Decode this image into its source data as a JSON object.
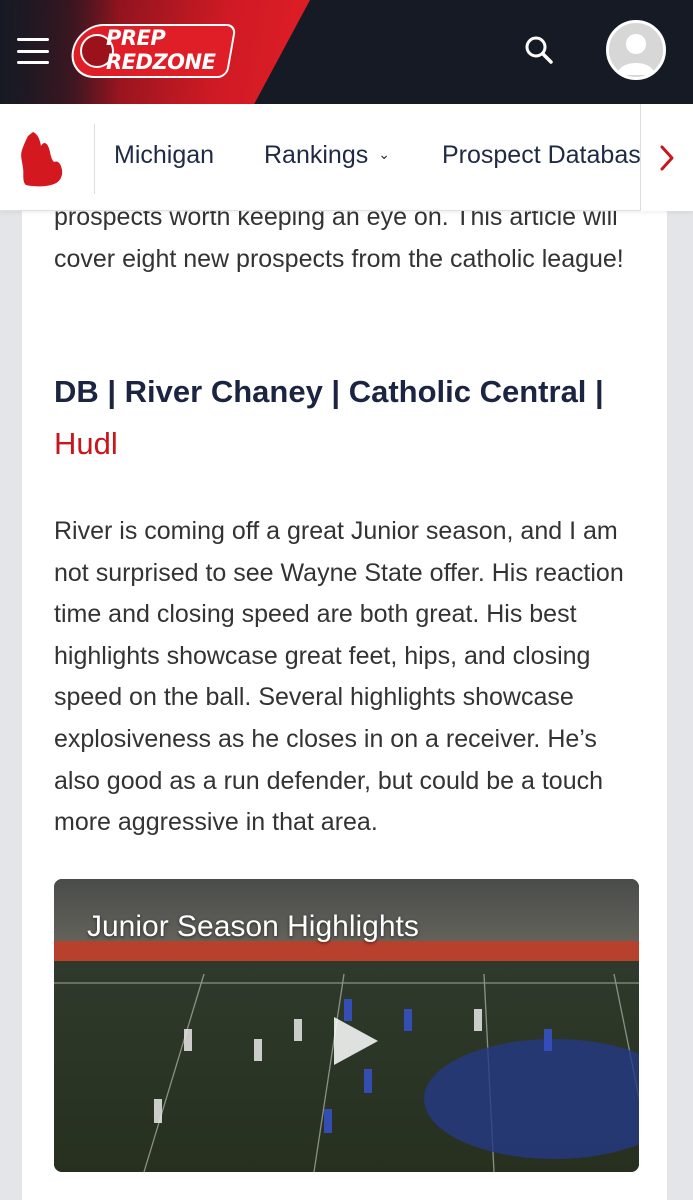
{
  "header": {
    "logo_line1": "PREP",
    "logo_line2": "REDZONE",
    "brand_color": "#e01e27",
    "header_bg": "#161a25"
  },
  "nav": {
    "state_icon": "michigan-state-icon",
    "items": [
      {
        "label": "Michigan"
      },
      {
        "label": "Rankings",
        "has_dropdown": true
      },
      {
        "label": "Prospect Database"
      }
    ]
  },
  "article": {
    "intro": "prospects worth keeping an eye on. This article will cover eight new prospects from the catholic league!",
    "heading": "DB | River Chaney | Catholic Central |",
    "heading_link": "Hudl",
    "body": "River is coming off a great Junior season, and I am not surprised to see Wayne State offer. His reaction time and closing speed are both great. His best highlights showcase great feet, hips, and closing speed on the ball. Several highlights showcase explosiveness as he closes in on a receiver. He’s also good as a run defender, but could be a touch more aggressive in that area.",
    "link_color": "#c8161d",
    "video": {
      "title": "Junior Season Highlights",
      "play_icon": "play-icon"
    }
  }
}
